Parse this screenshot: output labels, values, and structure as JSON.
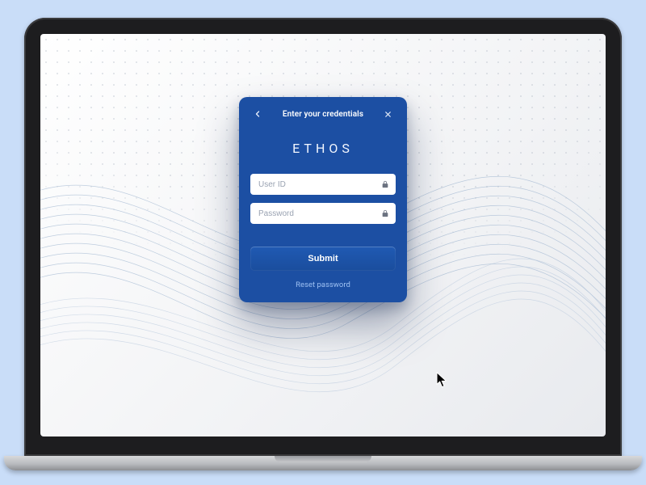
{
  "dialog": {
    "title": "Enter your credentials"
  },
  "brand": "ETHOS",
  "fields": {
    "user_id": {
      "placeholder": "User ID",
      "value": ""
    },
    "password": {
      "placeholder": "Password",
      "value": ""
    }
  },
  "actions": {
    "submit_label": "Submit",
    "reset_label": "Reset password"
  },
  "colors": {
    "card_bg": "#1c4fa3",
    "page_bg": "#c9ddf8",
    "link": "#9dc0f2"
  }
}
